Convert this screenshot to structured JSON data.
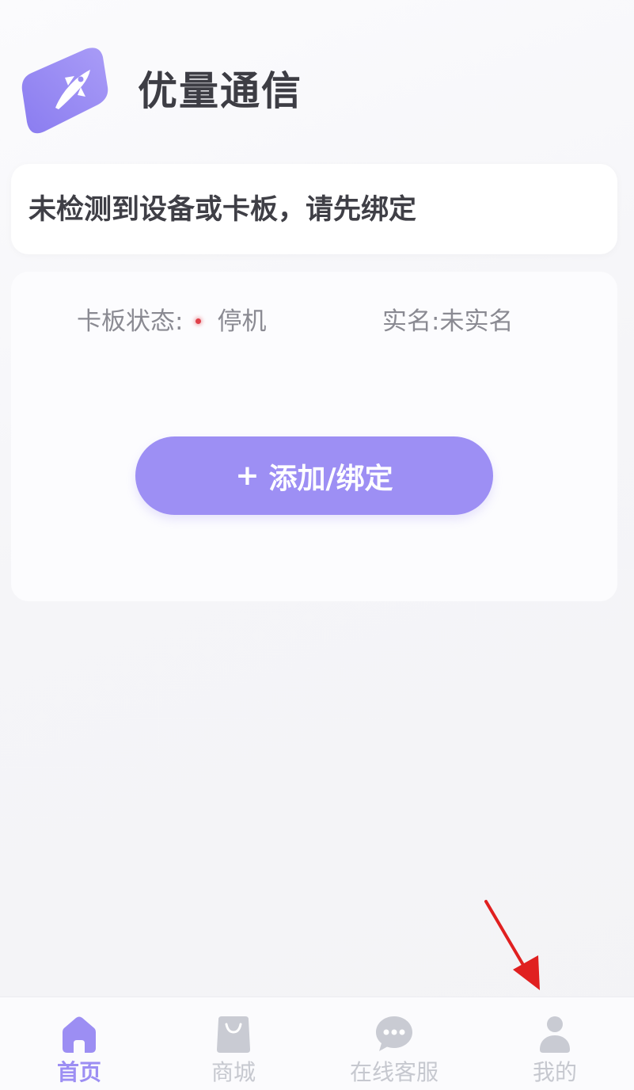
{
  "app": {
    "title": "优量通信",
    "logo_icon": "rocket-logo-icon"
  },
  "notice": {
    "text": "未检测到设备或卡板，请先绑定"
  },
  "status": {
    "board_label": "卡板状态:",
    "board_value": "停机",
    "board_status_color": "#e0414a",
    "realname_label": "实名:",
    "realname_value": "未实名"
  },
  "actions": {
    "add_bind_label": "添加/绑定",
    "add_bind_prefix": "+"
  },
  "tabbar": {
    "active_color": "#9c8ef3",
    "inactive_color": "#c6c8cf",
    "items": [
      {
        "label": "首页",
        "icon": "home-icon",
        "active": true
      },
      {
        "label": "商城",
        "icon": "shopping-bag-icon",
        "active": false
      },
      {
        "label": "在线客服",
        "icon": "chat-bubble-icon",
        "active": false
      },
      {
        "label": "我的",
        "icon": "user-profile-icon",
        "active": false
      }
    ]
  },
  "annotation": {
    "color": "#e02020",
    "icon": "red-arrow-pointer-icon"
  }
}
